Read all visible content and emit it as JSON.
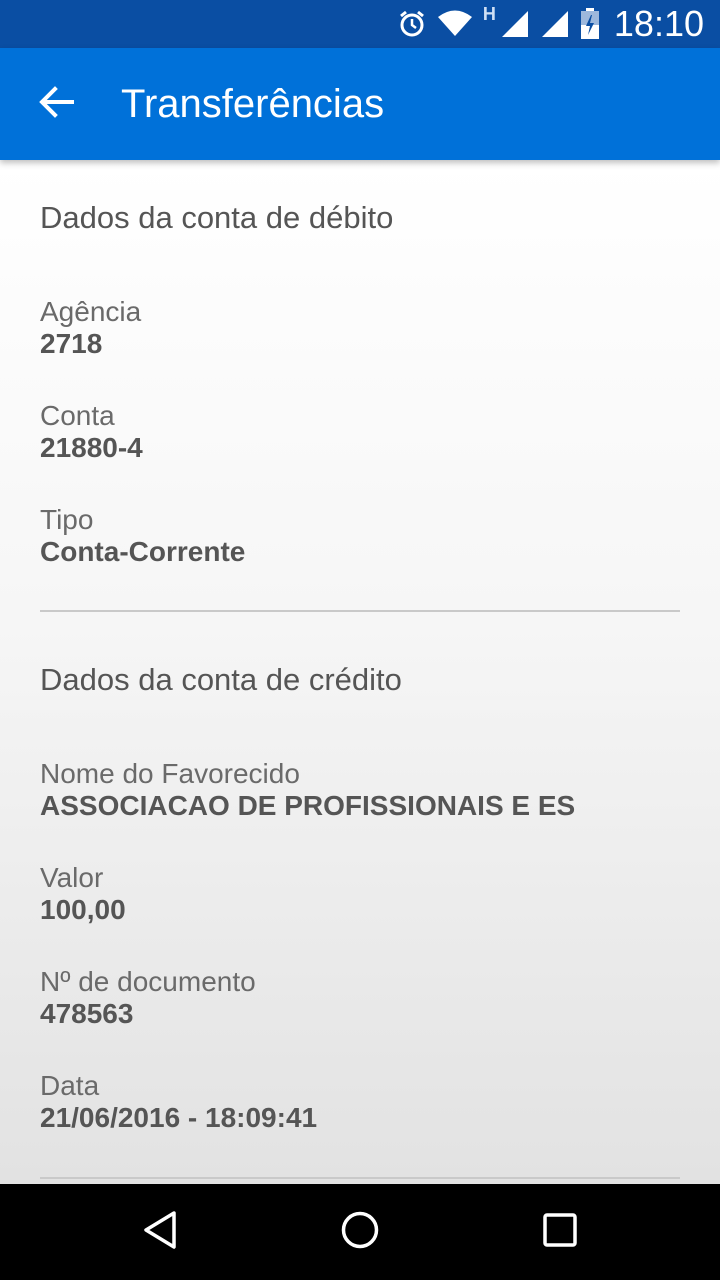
{
  "status_bar": {
    "time": "18:10",
    "network_type": "H",
    "icons": [
      "alarm-icon",
      "wifi-icon",
      "signal-icon",
      "signal-icon",
      "battery-icon"
    ]
  },
  "app_bar": {
    "title": "Transferências",
    "back_icon": "arrow-left-icon",
    "color": "#0071d9"
  },
  "debit": {
    "title": "Dados da conta de débito",
    "fields": [
      {
        "label": "Agência",
        "value": "2718"
      },
      {
        "label": "Conta",
        "value": "21880-4"
      },
      {
        "label": "Tipo",
        "value": "Conta-Corrente"
      }
    ]
  },
  "credit": {
    "title": "Dados da conta de crédito",
    "fields": [
      {
        "label": "Nome do Favorecido",
        "value": "ASSOCIACAO DE PROFISSIONAIS E ES"
      },
      {
        "label": "Valor",
        "value": "100,00"
      },
      {
        "label": "Nº de documento",
        "value": "478563"
      },
      {
        "label": "Data",
        "value": "21/06/2016 - 18:09:41"
      }
    ]
  },
  "nav_bar": {
    "buttons": [
      "back-triangle-icon",
      "home-circle-icon",
      "recents-square-icon"
    ]
  }
}
